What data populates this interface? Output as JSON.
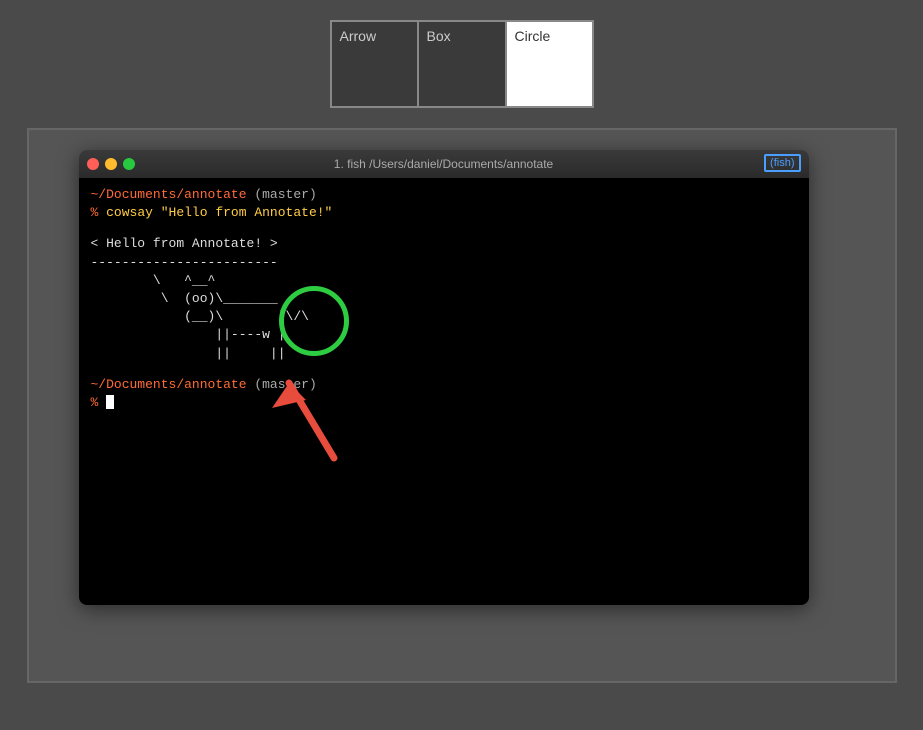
{
  "toolbar": {
    "buttons": [
      {
        "id": "arrow",
        "label": "Arrow",
        "active": false
      },
      {
        "id": "box",
        "label": "Box",
        "active": false
      },
      {
        "id": "circle",
        "label": "Circle",
        "active": true
      }
    ]
  },
  "terminal": {
    "title": "1. fish /Users/daniel/Documents/annotate",
    "fish_badge": "(fish)",
    "lines": [
      {
        "type": "path_master",
        "path": "~/Documents/annotate",
        "master": " (master)"
      },
      {
        "type": "command",
        "prompt": "% ",
        "text": "cowsay \"Hello from Annotate!\""
      },
      {
        "type": "blank"
      },
      {
        "type": "normal",
        "text": " < Hello from Annotate! >"
      },
      {
        "type": "normal",
        "text": " ------------------------"
      },
      {
        "type": "normal",
        "text": "        \\   ^__^"
      },
      {
        "type": "normal",
        "text": "         \\  (oo)\\_______"
      },
      {
        "type": "normal",
        "text": "            (__)\\       )\\/\\"
      },
      {
        "type": "normal",
        "text": "                ||----w |"
      },
      {
        "type": "normal",
        "text": "                ||     ||"
      },
      {
        "type": "blank"
      },
      {
        "type": "path_master",
        "path": "~/Documents/annotate",
        "master": " (master)"
      },
      {
        "type": "prompt_cursor",
        "prompt": "% "
      }
    ]
  },
  "annotations": {
    "circle": {
      "description": "Green circle annotation around cow ascii art",
      "color": "#2ecc40"
    },
    "arrow": {
      "description": "Red arrow pointing up-left toward circle",
      "color": "#e74c3c"
    }
  }
}
